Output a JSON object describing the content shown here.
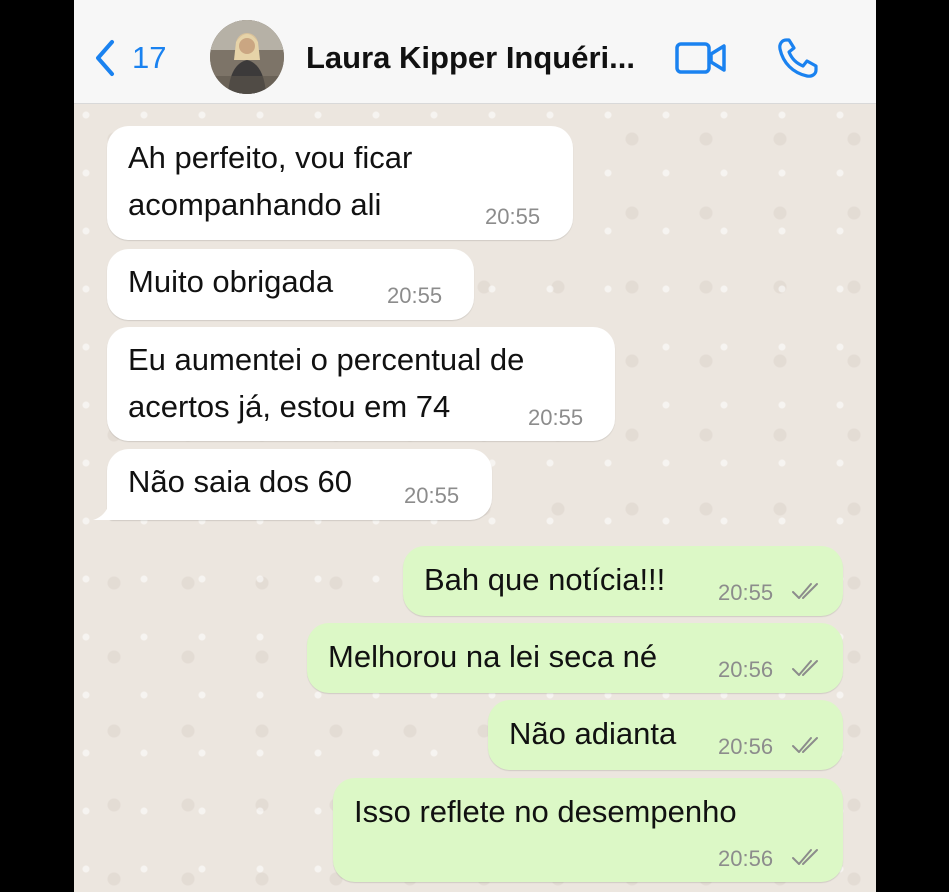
{
  "header": {
    "back_count": "17",
    "contact_name": "Laura Kipper Inquéri..."
  },
  "icons": {
    "back": "chevron-left-icon",
    "video": "video-call-icon",
    "call": "phone-icon",
    "read": "double-check-icon"
  },
  "colors": {
    "accent": "#1a82f0",
    "incoming_bubble": "#ffffff",
    "outgoing_bubble": "#dcf8c6",
    "time_text": "#8c8c8c",
    "ticks": "#8c8c8c"
  },
  "messages": [
    {
      "direction": "in",
      "lines": [
        "Ah perfeito, vou ficar",
        "acompanhando ali"
      ],
      "time": "20:55"
    },
    {
      "direction": "in",
      "lines": [
        "Muito obrigada"
      ],
      "time": "20:55"
    },
    {
      "direction": "in",
      "lines": [
        "Eu aumentei o percentual de",
        "acertos já, estou em 74"
      ],
      "time": "20:55"
    },
    {
      "direction": "in",
      "lines": [
        "Não saia dos 60"
      ],
      "time": "20:55"
    },
    {
      "direction": "out",
      "lines": [
        "Bah que notícia!!!"
      ],
      "time": "20:55",
      "status": "read"
    },
    {
      "direction": "out",
      "lines": [
        "Melhorou na lei seca né"
      ],
      "time": "20:56",
      "status": "read"
    },
    {
      "direction": "out",
      "lines": [
        "Não adianta"
      ],
      "time": "20:56",
      "status": "read"
    },
    {
      "direction": "out",
      "lines": [
        "Isso reflete no desempenho"
      ],
      "time": "20:56",
      "status": "read"
    }
  ]
}
